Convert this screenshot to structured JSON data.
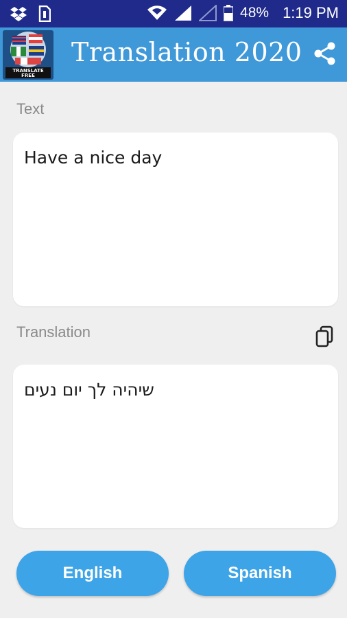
{
  "status_bar": {
    "battery": "48%",
    "time": "1:19 PM",
    "icons": [
      "dropbox-icon",
      "sim-icon",
      "wifi-icon",
      "signal-icon",
      "signal-empty-icon",
      "battery-icon"
    ]
  },
  "app_bar": {
    "title": "Translation 2020",
    "logo_text": "TRANSLATE FREE",
    "share_icon": "share-icon",
    "color": "#3f98d8"
  },
  "input": {
    "label": "Text",
    "value": "Have a nice day"
  },
  "output": {
    "label": "Translation",
    "value": "שיהיה לך יום נעים",
    "copy_icon": "copy-icon"
  },
  "buttons": {
    "source_language": "English",
    "target_language": "Spanish",
    "color": "#3da4e8"
  }
}
